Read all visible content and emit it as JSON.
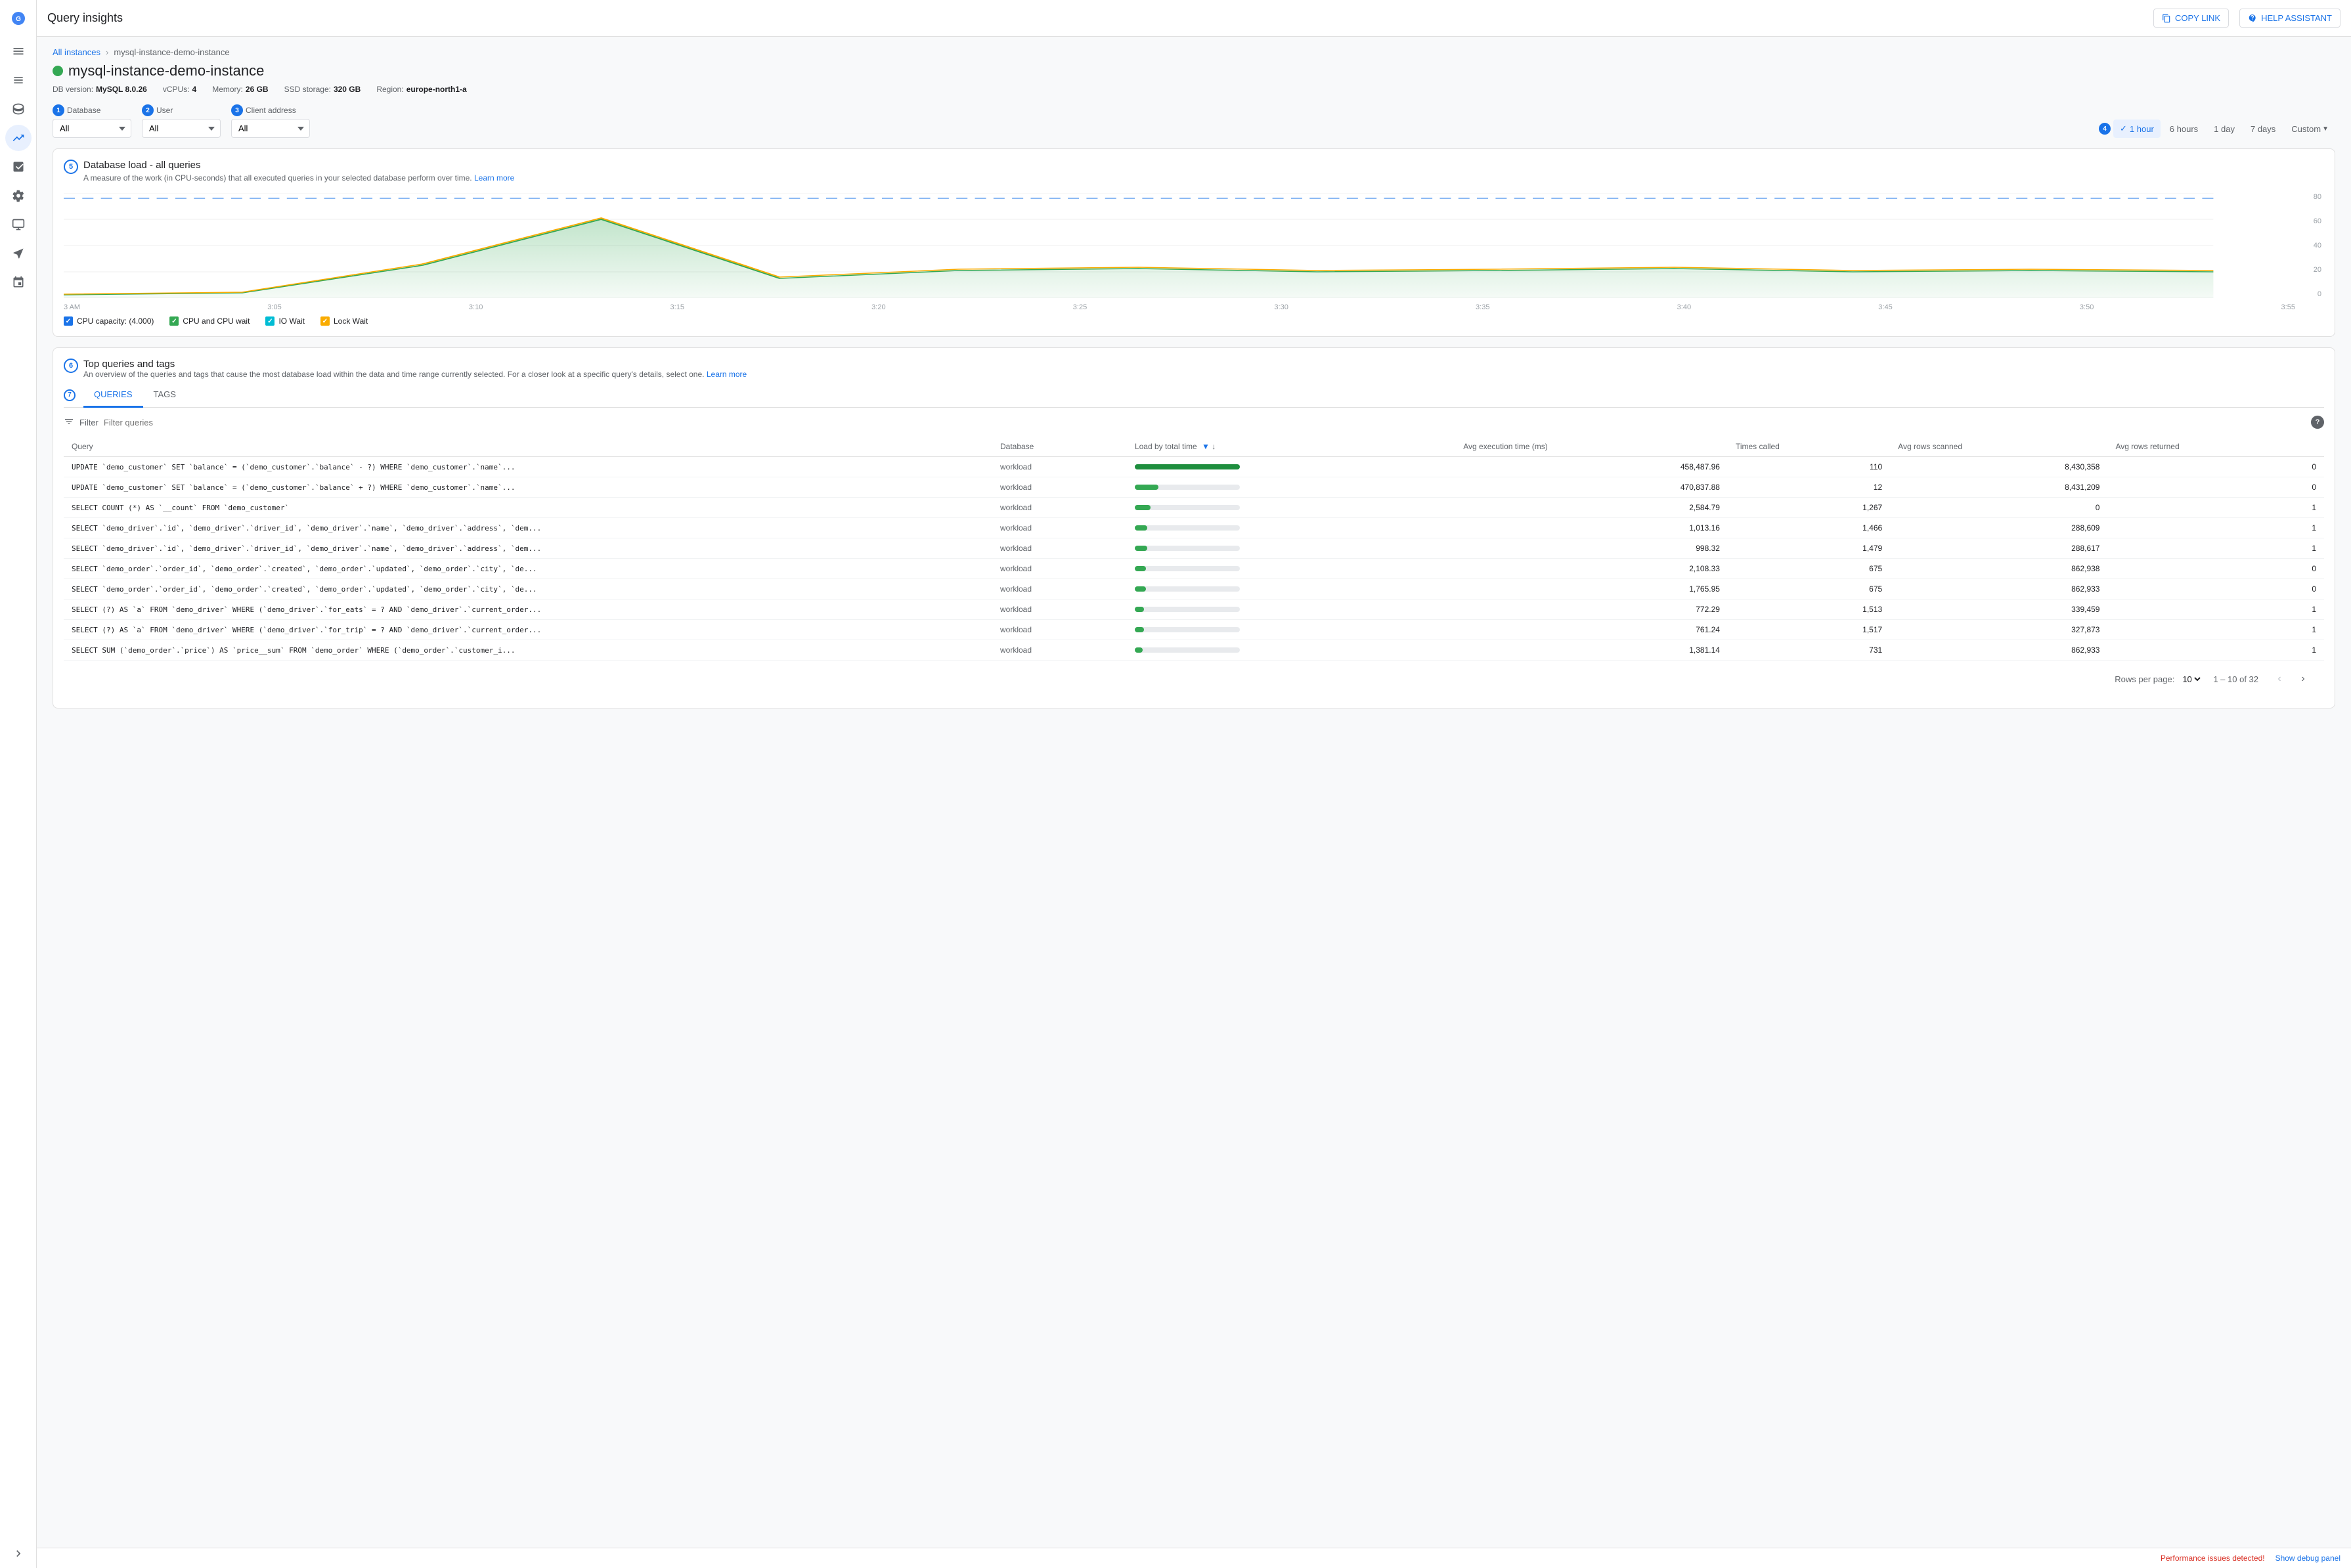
{
  "topbar": {
    "title": "Query insights",
    "copy_link_label": "COPY LINK",
    "help_label": "HELP ASSISTANT"
  },
  "breadcrumb": {
    "all_instances": "All instances",
    "separator": "›",
    "current": "mysql-instance-demo-instance"
  },
  "instance": {
    "name": "mysql-instance-demo-instance",
    "db_version_label": "DB version:",
    "db_version": "MySQL 8.0.26",
    "vcpus_label": "vCPUs:",
    "vcpus": "4",
    "memory_label": "Memory:",
    "memory": "26 GB",
    "storage_label": "SSD storage:",
    "storage": "320 GB",
    "region_label": "Region:",
    "region": "europe-north1-a"
  },
  "filters": {
    "database": {
      "label": "Database",
      "value": "All",
      "step": "1"
    },
    "user": {
      "label": "User",
      "value": "All",
      "step": "2"
    },
    "client_address": {
      "label": "Client address",
      "value": "All",
      "step": "3"
    }
  },
  "time_range": {
    "step": "4",
    "options": [
      "1 hour",
      "6 hours",
      "1 day",
      "7 days",
      "Custom"
    ],
    "active": "1 hour"
  },
  "chart": {
    "title": "Database load - all queries",
    "description": "A measure of the work (in CPU-seconds) that all executed queries in your selected database perform over time.",
    "learn_more": "Learn more",
    "section_num": "5",
    "y_labels": [
      "80",
      "60",
      "40",
      "20",
      "0"
    ],
    "x_labels": [
      "3 AM",
      "3:05",
      "3:10",
      "3:15",
      "3:20",
      "3:25",
      "3:30",
      "3:35",
      "3:40",
      "3:45",
      "3:50",
      "3:55"
    ],
    "legend": [
      {
        "id": "cpu_capacity",
        "label": "CPU capacity: (4.000)",
        "color": "blue"
      },
      {
        "id": "cpu_cpu_wait",
        "label": "CPU and CPU wait",
        "color": "green"
      },
      {
        "id": "io_wait",
        "label": "IO Wait",
        "color": "teal"
      },
      {
        "id": "lock_wait",
        "label": "Lock Wait",
        "color": "orange"
      }
    ]
  },
  "top_queries": {
    "title": "Top queries and tags",
    "description": "An overview of the queries and tags that cause the most database load within the data and time range currently selected. For a closer look at a specific query's details, select one.",
    "learn_more": "Learn more",
    "section_num": "6",
    "tabs": [
      {
        "id": "queries",
        "label": "QUERIES",
        "active": true
      },
      {
        "id": "tags",
        "label": "TAGS",
        "active": false
      }
    ],
    "filter_placeholder": "Filter queries",
    "columns": [
      {
        "id": "query",
        "label": "Query",
        "sortable": false
      },
      {
        "id": "database",
        "label": "Database",
        "sortable": false
      },
      {
        "id": "load_total_time",
        "label": "Load by total time",
        "sortable": true,
        "active": true
      },
      {
        "id": "avg_execution",
        "label": "Avg execution time (ms)",
        "sortable": false
      },
      {
        "id": "times_called",
        "label": "Times called",
        "sortable": false
      },
      {
        "id": "avg_rows_scanned",
        "label": "Avg rows scanned",
        "sortable": false
      },
      {
        "id": "avg_rows_returned",
        "label": "Avg rows returned",
        "sortable": false
      }
    ],
    "rows": [
      {
        "query": "UPDATE `demo_customer` SET `balance` = (`demo_customer`.`balance` - ?) WHERE `demo_customer`.`name`...",
        "database": "workload",
        "load_pct": 95,
        "avg_execution": "458,487.96",
        "times_called": "110",
        "avg_rows_scanned": "8,430,358",
        "avg_rows_returned": "0"
      },
      {
        "query": "UPDATE `demo_customer` SET `balance` = (`demo_customer`.`balance` + ?) WHERE `demo_customer`.`name`...",
        "database": "workload",
        "load_pct": 15,
        "avg_execution": "470,837.88",
        "times_called": "12",
        "avg_rows_scanned": "8,431,209",
        "avg_rows_returned": "0"
      },
      {
        "query": "SELECT COUNT (*) AS `__count` FROM `demo_customer`",
        "database": "workload",
        "load_pct": 10,
        "avg_execution": "2,584.79",
        "times_called": "1,267",
        "avg_rows_scanned": "0",
        "avg_rows_returned": "1"
      },
      {
        "query": "SELECT `demo_driver`.`id`, `demo_driver`.`driver_id`, `demo_driver`.`name`, `demo_driver`.`address`, `dem...",
        "database": "workload",
        "load_pct": 8,
        "avg_execution": "1,013.16",
        "times_called": "1,466",
        "avg_rows_scanned": "288,609",
        "avg_rows_returned": "1"
      },
      {
        "query": "SELECT `demo_driver`.`id`, `demo_driver`.`driver_id`, `demo_driver`.`name`, `demo_driver`.`address`, `dem...",
        "database": "workload",
        "load_pct": 8,
        "avg_execution": "998.32",
        "times_called": "1,479",
        "avg_rows_scanned": "288,617",
        "avg_rows_returned": "1"
      },
      {
        "query": "SELECT `demo_order`.`order_id`, `demo_order`.`created`, `demo_order`.`updated`, `demo_order`.`city`, `de...",
        "database": "workload",
        "load_pct": 7,
        "avg_execution": "2,108.33",
        "times_called": "675",
        "avg_rows_scanned": "862,938",
        "avg_rows_returned": "0"
      },
      {
        "query": "SELECT `demo_order`.`order_id`, `demo_order`.`created`, `demo_order`.`updated`, `demo_order`.`city`, `de...",
        "database": "workload",
        "load_pct": 7,
        "avg_execution": "1,765.95",
        "times_called": "675",
        "avg_rows_scanned": "862,933",
        "avg_rows_returned": "0"
      },
      {
        "query": "SELECT (?) AS `a` FROM `demo_driver` WHERE (`demo_driver`.`for_eats` = ? AND `demo_driver`.`current_order...",
        "database": "workload",
        "load_pct": 6,
        "avg_execution": "772.29",
        "times_called": "1,513",
        "avg_rows_scanned": "339,459",
        "avg_rows_returned": "1"
      },
      {
        "query": "SELECT (?) AS `a` FROM `demo_driver` WHERE (`demo_driver`.`for_trip` = ? AND `demo_driver`.`current_order...",
        "database": "workload",
        "load_pct": 6,
        "avg_execution": "761.24",
        "times_called": "1,517",
        "avg_rows_scanned": "327,873",
        "avg_rows_returned": "1"
      },
      {
        "query": "SELECT SUM (`demo_order`.`price`) AS `price__sum` FROM `demo_order` WHERE (`demo_order`.`customer_i...",
        "database": "workload",
        "load_pct": 5,
        "avg_execution": "1,381.14",
        "times_called": "731",
        "avg_rows_scanned": "862,933",
        "avg_rows_returned": "1"
      }
    ],
    "pagination": {
      "rows_per_page_label": "Rows per page:",
      "rows_per_page": "10",
      "range": "1 – 10 of 32"
    }
  },
  "status_bar": {
    "error_text": "Performance issues detected!",
    "debug_link": "Show debug panel"
  },
  "sidebar": {
    "items": [
      {
        "id": "menu",
        "icon": "☰"
      },
      {
        "id": "home",
        "icon": "⊞"
      },
      {
        "id": "nav1",
        "icon": "→"
      },
      {
        "id": "insights",
        "icon": "📊",
        "active": true
      },
      {
        "id": "nav2",
        "icon": "⊡"
      },
      {
        "id": "nav3",
        "icon": "⊟"
      },
      {
        "id": "nav4",
        "icon": "≡"
      },
      {
        "id": "nav5",
        "icon": "⊠"
      },
      {
        "id": "nav6",
        "icon": "◫"
      }
    ]
  }
}
